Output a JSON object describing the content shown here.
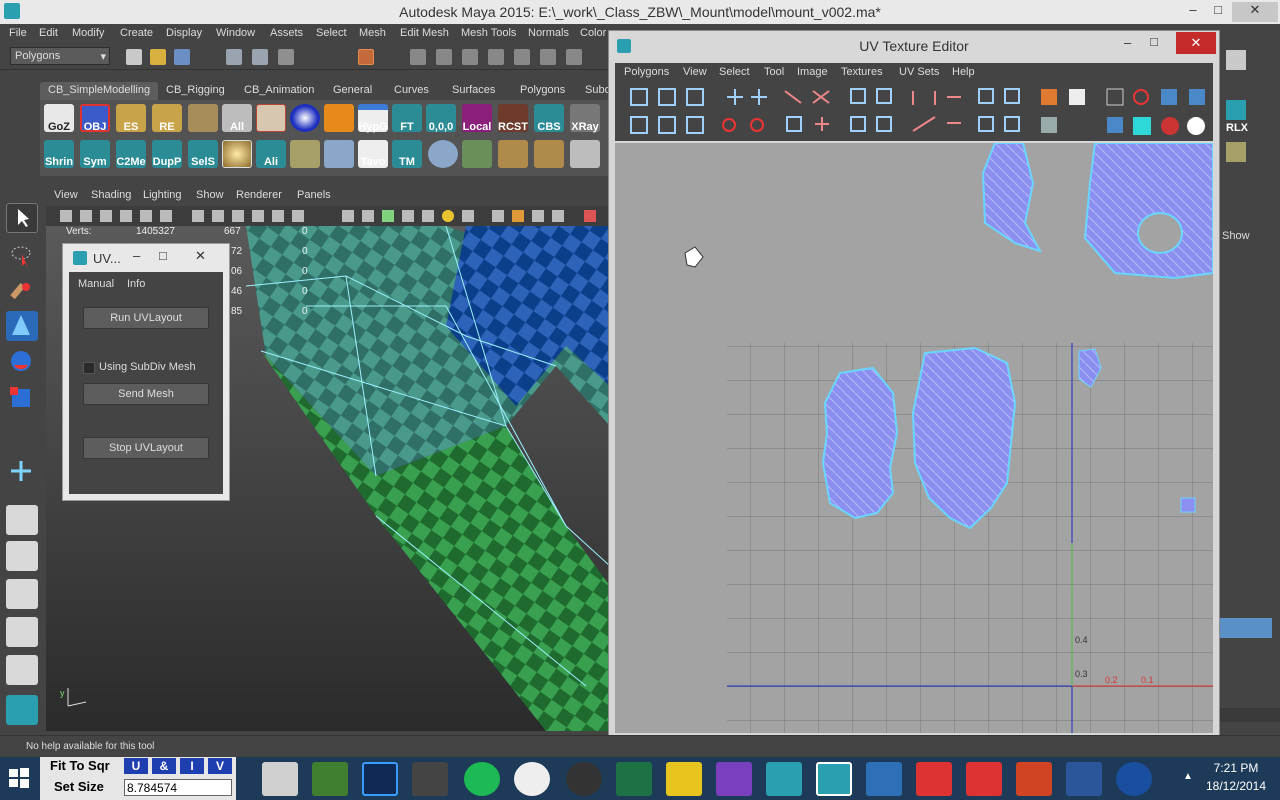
{
  "window": {
    "title": "Autodesk Maya 2015: E:\\_work\\_Class_ZBW\\_Mount\\model\\mount_v002.ma*",
    "minimize": "–",
    "maximize": "□",
    "close": "✕"
  },
  "menubar": [
    "File",
    "Edit",
    "Modify",
    "Create",
    "Display",
    "Window",
    "Assets",
    "Select",
    "Mesh",
    "Edit Mesh",
    "Mesh Tools",
    "Normals",
    "Color"
  ],
  "statusline": {
    "mode": "Polygons"
  },
  "shelf": {
    "tabs": [
      "CB_SimpleModelling",
      "CB_Rigging",
      "CB_Animation",
      "General",
      "Curves",
      "Surfaces",
      "Polygons",
      "Subd"
    ],
    "active_tab": "CB_SimpleModelling",
    "row1": [
      "GoZ",
      "OBJ",
      "ES",
      "RE",
      "",
      "All",
      "",
      "",
      "HypG",
      "FT",
      "0,0,0",
      "Local",
      "RCST",
      "CBS",
      "XRay"
    ],
    "row2": [
      "Shrin",
      "Sym",
      "C2Me",
      "DupP",
      "SelS",
      "",
      "Ali",
      "",
      "",
      "Tavo",
      "TM",
      "",
      "",
      "",
      "",
      ""
    ]
  },
  "viewport": {
    "menu": [
      "View",
      "Shading",
      "Lighting",
      "Show",
      "Renderer",
      "Panels"
    ],
    "hud": {
      "label": "Verts:",
      "col1": [
        "1405327"
      ],
      "col2": [
        "667",
        "72",
        "06",
        "46",
        "85"
      ],
      "col3": [
        "0",
        "0",
        "0",
        "0",
        "0"
      ]
    }
  },
  "uv_panel": {
    "title": "UV...",
    "menu": [
      "Manual",
      "Info"
    ],
    "run": "Run UVLayout",
    "subdiv_label": "Using SubDiv Mesh",
    "send": "Send Mesh",
    "stop": "Stop UVLayout"
  },
  "uv_editor": {
    "title": "UV Texture Editor",
    "menu": [
      "Polygons",
      "View",
      "Select",
      "Tool",
      "Image",
      "Textures",
      "UV Sets",
      "Help"
    ],
    "axis_labels": [
      "0.4",
      "0.3",
      "0.2",
      "0.1"
    ]
  },
  "rightbar": {
    "show": "Show"
  },
  "helpline": {
    "text": "No help available for this tool"
  },
  "taskbar": {
    "fit_to_sqr": "Fit To Sqr",
    "set_size_label": "Set Size",
    "set_size_value": "8.784574",
    "uv_buttons": [
      "U",
      "&",
      "I",
      "V"
    ],
    "time": "7:21 PM",
    "date": "18/12/2014"
  },
  "colors": {
    "accent_uv": "#8a8ff0",
    "uv_outline": "#6ad5ff",
    "taskbar": "#1d3b58"
  }
}
